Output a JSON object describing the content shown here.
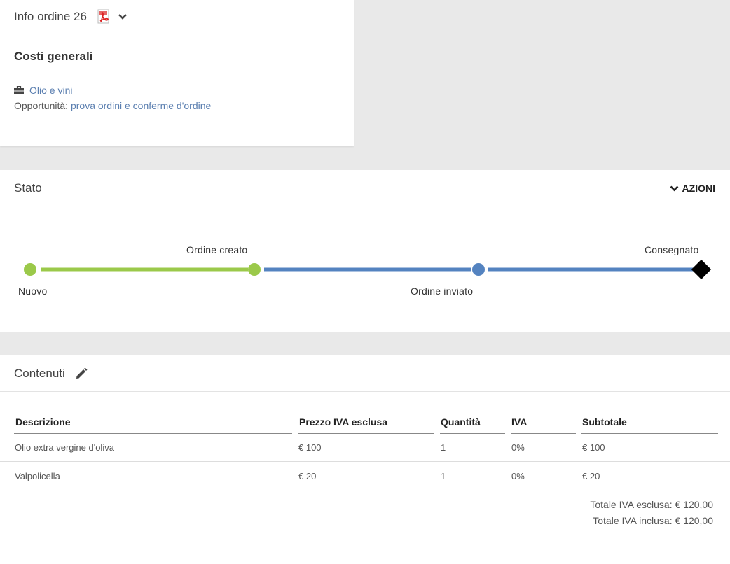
{
  "info": {
    "title": "Info ordine 26",
    "section_title": "Costi generali",
    "company_link": "Olio e vini",
    "opportunity_label": "Opportunità:",
    "opportunity_link": "prova ordini e conferme d'ordine"
  },
  "stato": {
    "title": "Stato",
    "azioni_label": "AZIONI",
    "steps": [
      {
        "label": "Nuovo",
        "status": "done"
      },
      {
        "label": "Ordine creato",
        "status": "done"
      },
      {
        "label": "Ordine inviato",
        "status": "current"
      },
      {
        "label": "Consegnato",
        "status": "final"
      }
    ],
    "colors": {
      "done": "#9bc94a",
      "pending": "#5483c0",
      "final": "#000000"
    }
  },
  "contenuti": {
    "title": "Contenuti",
    "columns": [
      "Descrizione",
      "Prezzo IVA esclusa",
      "Quantità",
      "IVA",
      "Subtotale"
    ],
    "rows": [
      [
        "Olio extra vergine d'oliva",
        "€ 100",
        "1",
        "0%",
        "€ 100"
      ],
      [
        "Valpolicella",
        "€ 20",
        "1",
        "0%",
        "€ 20"
      ]
    ],
    "total_excl": "Totale IVA esclusa: € 120,00",
    "total_incl": "Totale IVA inclusa: € 120,00"
  }
}
